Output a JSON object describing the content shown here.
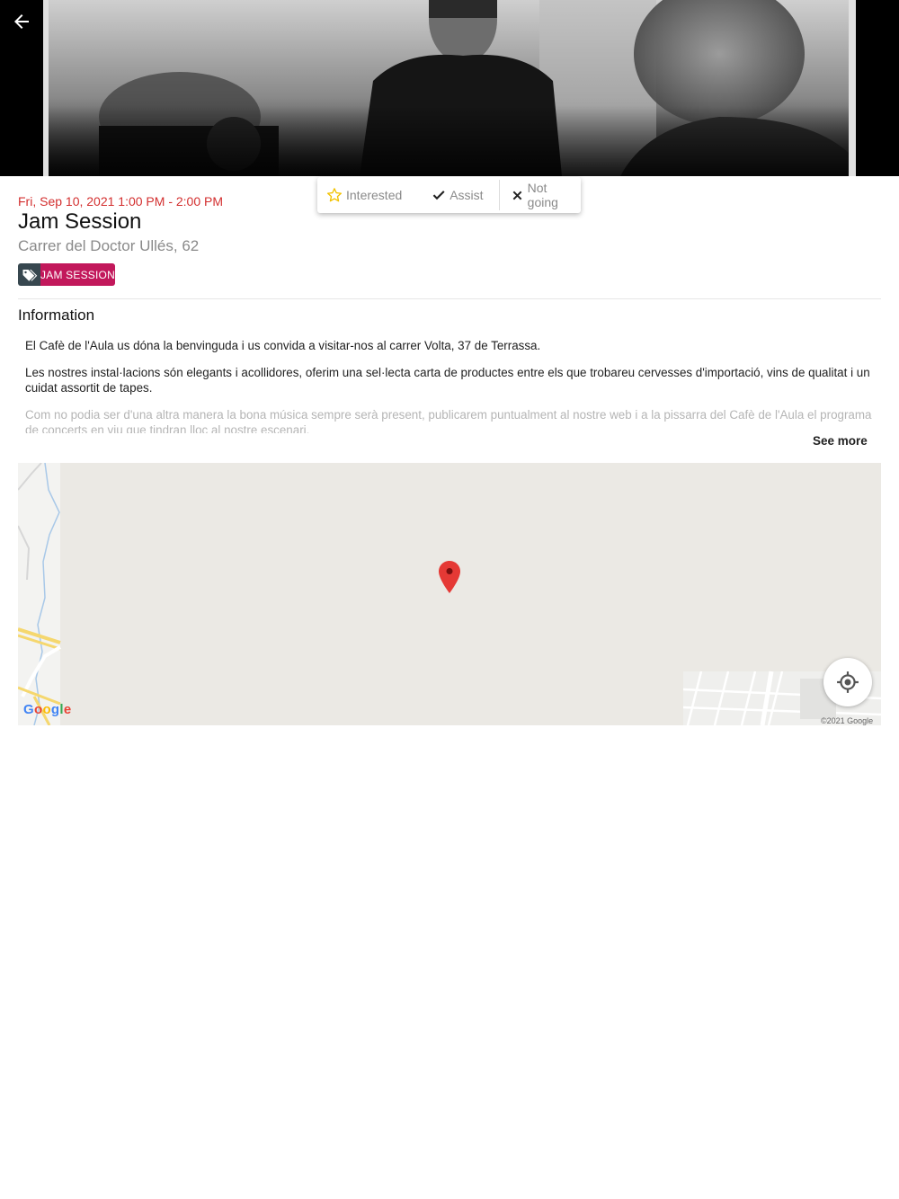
{
  "hero": {
    "image": "jam-session-photo"
  },
  "nav": {
    "back_icon": "arrow-left-icon"
  },
  "rsvp": {
    "interested_label": "Interested",
    "assist_label": "Assist",
    "not_going_label": "Not going"
  },
  "event": {
    "datetime": "Fri, Sep 10, 2021 1:00 PM - 2:00 PM",
    "title": "Jam Session",
    "address": "Carrer del Doctor Ullés, 62",
    "tag": "JAM SESSION"
  },
  "information": {
    "heading": "Information",
    "paragraphs": [
      "El Cafè de l'Aula us dóna la benvinguda i us convida a visitar-nos al carrer Volta, 37 de Terrassa.",
      "Les nostres instal·lacions són elegants i acollidores, oferim una sel·lecta carta de productes entre els que trobareu cervesses d'importació, vins de qualitat i un cuidat assortit de tapes.",
      "Com no podia ser d'una altra manera la bona música sempre serà present, publicarem puntualment al nostre web i a la pissarra del Cafè de l'Aula el programa de concerts en viu que tindran lloc al nostre escenari."
    ],
    "see_more": "See more"
  },
  "map": {
    "logo": "Google",
    "copyright": "©2021 Google"
  },
  "colors": {
    "date": "#d32f2f",
    "tag_label_bg": "#c2185b",
    "tag_icon_bg": "#37474f",
    "map_bg": "#ebe9e4",
    "pin": "#e53935"
  }
}
